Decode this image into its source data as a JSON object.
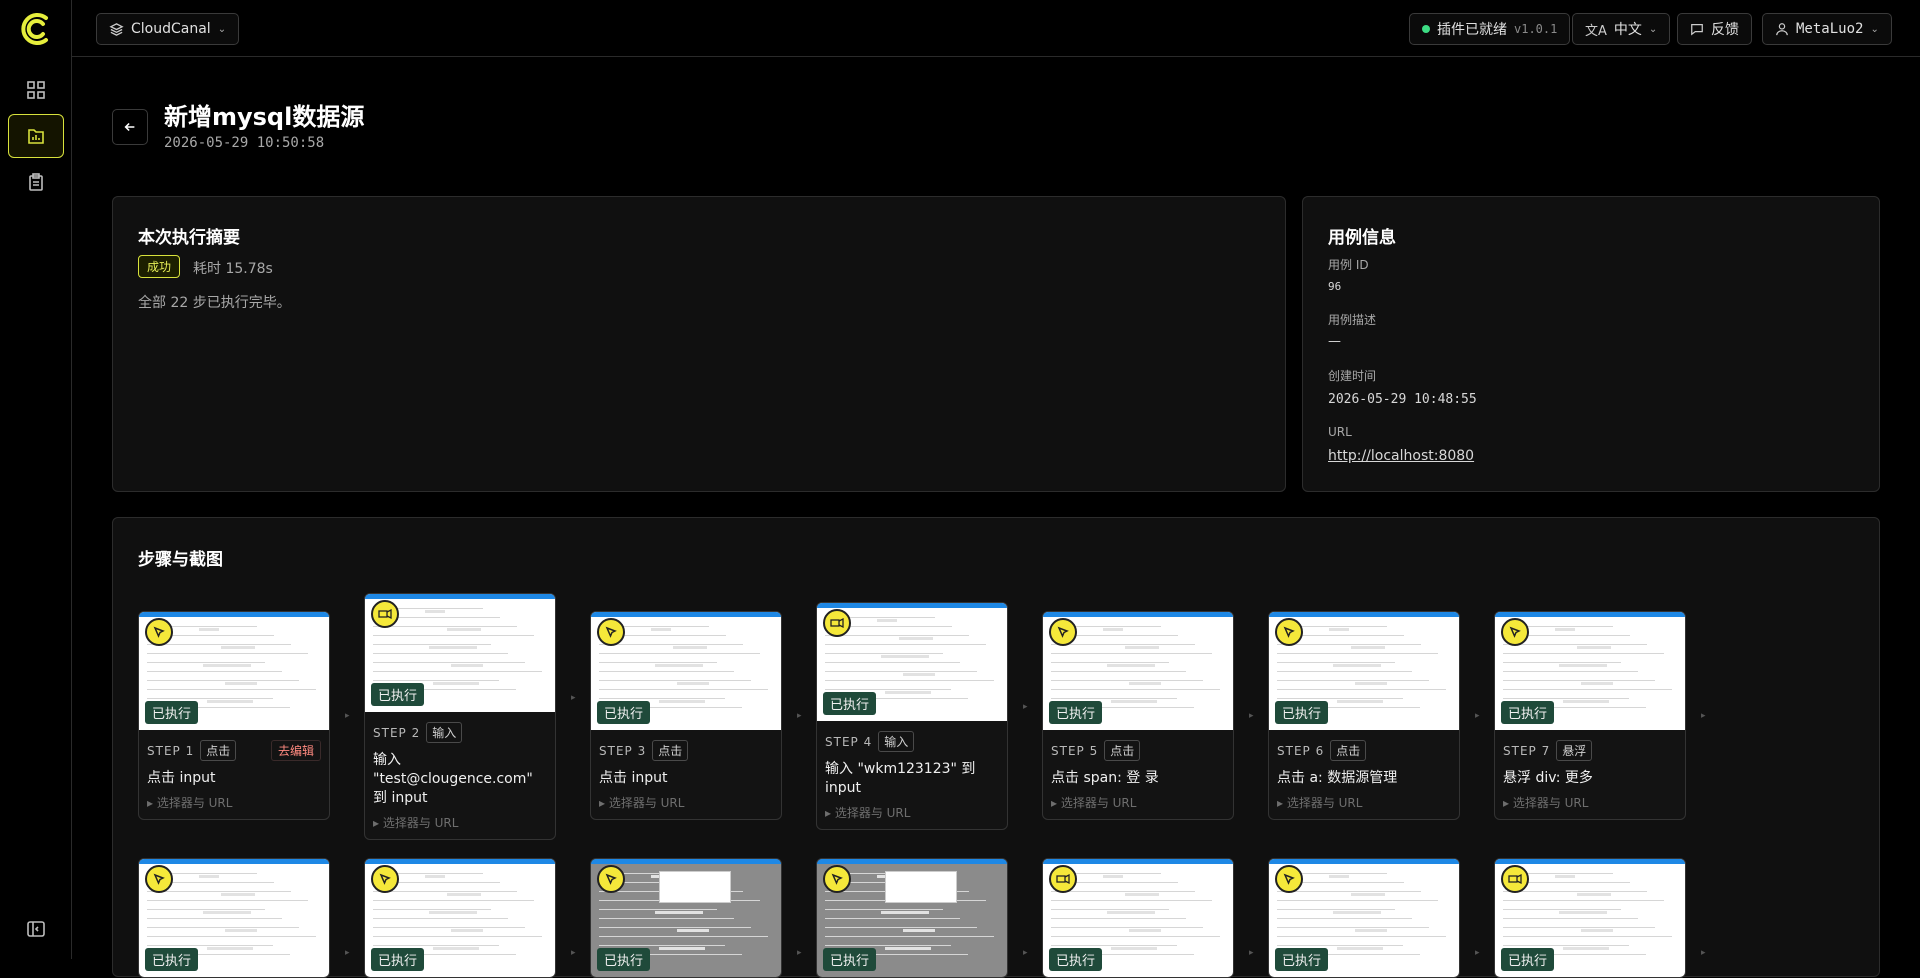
{
  "app": {
    "workspace_label": "CloudCanal"
  },
  "topbar": {
    "plugin_status": "插件已就绪",
    "plugin_version": "v1.0.1",
    "language": "中文",
    "feedback": "反馈",
    "user": "MetaLuo2"
  },
  "page": {
    "title": "新增mysql数据源",
    "time": "2026-05-29 10:50:58"
  },
  "summary": {
    "title": "本次执行摘要",
    "status": "成功",
    "duration": "耗时 15.78s",
    "text": "全部 22 步已执行完毕。"
  },
  "case_info": {
    "title": "用例信息",
    "id_label": "用例 ID",
    "id_value": "96",
    "desc_label": "用例描述",
    "desc_value": "—",
    "created_label": "创建时间",
    "created_value": "2026-05-29 10:48:55",
    "url_label": "URL",
    "url_value": "http://localhost:8080"
  },
  "steps_section": {
    "title": "步骤与截图"
  },
  "steps": [
    {
      "label": "STEP 1",
      "action": "点击",
      "edit": "去编辑",
      "title": "点击 input",
      "selector": "▸ 选择器与 URL",
      "status": "已执行",
      "icon": "cursor-icon"
    },
    {
      "label": "STEP 2",
      "action": "输入",
      "edit": "",
      "title": "输入 \"test@clougence.com\" 到 input",
      "selector": "▸ 选择器与 URL",
      "status": "已执行",
      "icon": "keyboard-icon"
    },
    {
      "label": "STEP 3",
      "action": "点击",
      "edit": "",
      "title": "点击 input",
      "selector": "▸ 选择器与 URL",
      "status": "已执行",
      "icon": "cursor-icon"
    },
    {
      "label": "STEP 4",
      "action": "输入",
      "edit": "",
      "title": "输入 \"wkm123123\" 到 input",
      "selector": "▸ 选择器与 URL",
      "status": "已执行",
      "icon": "keyboard-icon"
    },
    {
      "label": "STEP 5",
      "action": "点击",
      "edit": "",
      "title": "点击 span: 登 录",
      "selector": "▸ 选择器与 URL",
      "status": "已执行",
      "icon": "cursor-icon"
    },
    {
      "label": "STEP 6",
      "action": "点击",
      "edit": "",
      "title": "点击 a: 数据源管理",
      "selector": "▸ 选择器与 URL",
      "status": "已执行",
      "icon": "cursor-icon"
    },
    {
      "label": "STEP 7",
      "action": "悬浮",
      "edit": "",
      "title": "悬浮 div: 更多",
      "selector": "▸ 选择器与 URL",
      "status": "已执行",
      "icon": "cursor-icon"
    },
    {
      "status": "已执行",
      "icon": "cursor-icon"
    },
    {
      "status": "已执行",
      "icon": "cursor-icon"
    },
    {
      "status": "已执行",
      "icon": "cursor-icon"
    },
    {
      "status": "已执行",
      "icon": "cursor-icon"
    },
    {
      "status": "已执行",
      "icon": "keyboard-icon"
    },
    {
      "status": "已执行",
      "icon": "cursor-icon"
    },
    {
      "status": "已执行",
      "icon": "keyboard-icon"
    }
  ]
}
